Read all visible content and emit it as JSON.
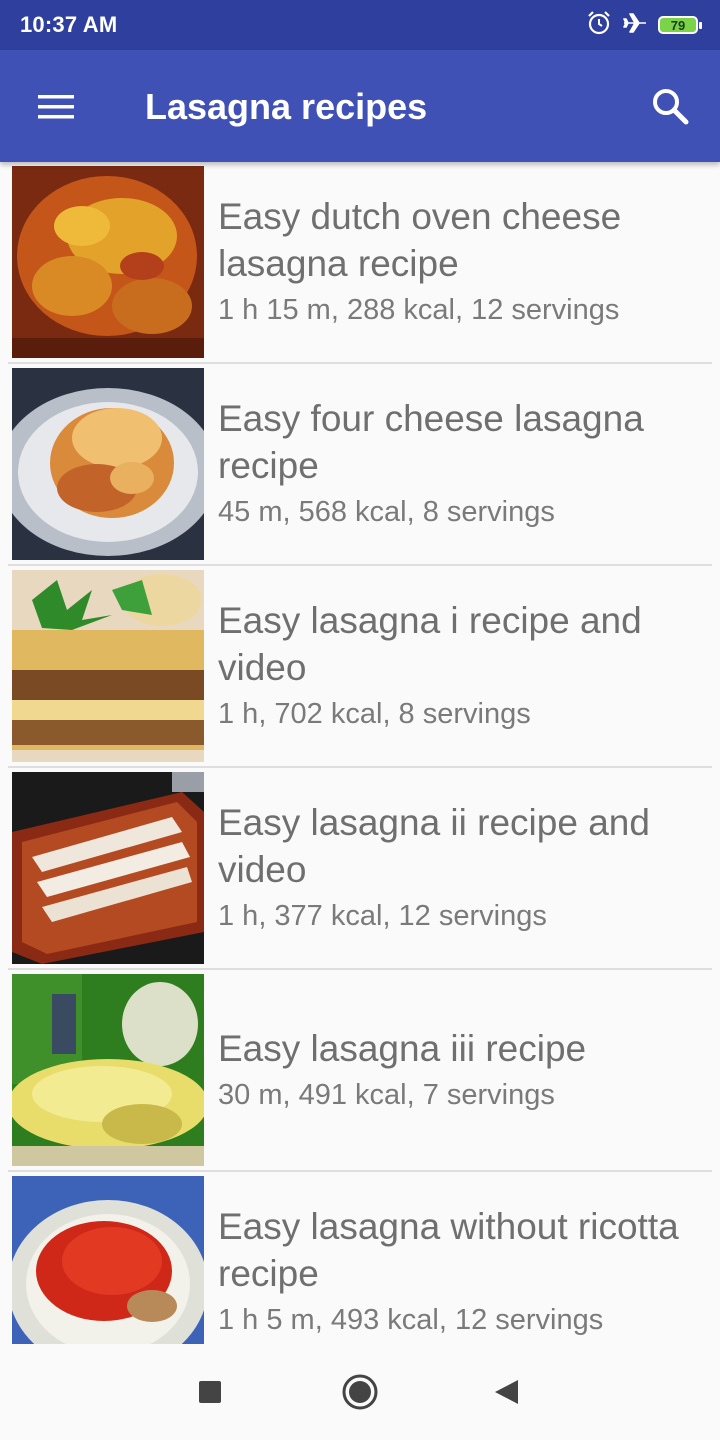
{
  "status_bar": {
    "time": "10:37 AM",
    "battery_level": "79",
    "icons": [
      "alarm-icon",
      "airplane-mode-icon",
      "battery-icon"
    ]
  },
  "app_bar": {
    "title": "Lasagna recipes",
    "menu_icon": "hamburger-menu-icon",
    "search_icon": "search-icon",
    "color": "#3f51b5"
  },
  "recipes": [
    {
      "title": "Easy dutch oven cheese lasagna recipe",
      "meta": "1 h 15 m, 288 kcal, 12 servings"
    },
    {
      "title": "Easy four cheese lasagna recipe",
      "meta": "45 m, 568 kcal, 8 servings"
    },
    {
      "title": "Easy lasagna i recipe and video",
      "meta": "1 h, 702 kcal, 8 servings"
    },
    {
      "title": "Easy lasagna ii recipe and video",
      "meta": "1 h, 377 kcal, 12 servings"
    },
    {
      "title": "Easy lasagna iii recipe",
      "meta": "30 m, 491 kcal, 7 servings"
    },
    {
      "title": "Easy lasagna without ricotta recipe",
      "meta": "1 h 5 m, 493 kcal, 12 servings"
    }
  ],
  "nav_bar": {
    "icons": [
      "recents-square-icon",
      "home-circle-icon",
      "back-triangle-icon"
    ]
  }
}
